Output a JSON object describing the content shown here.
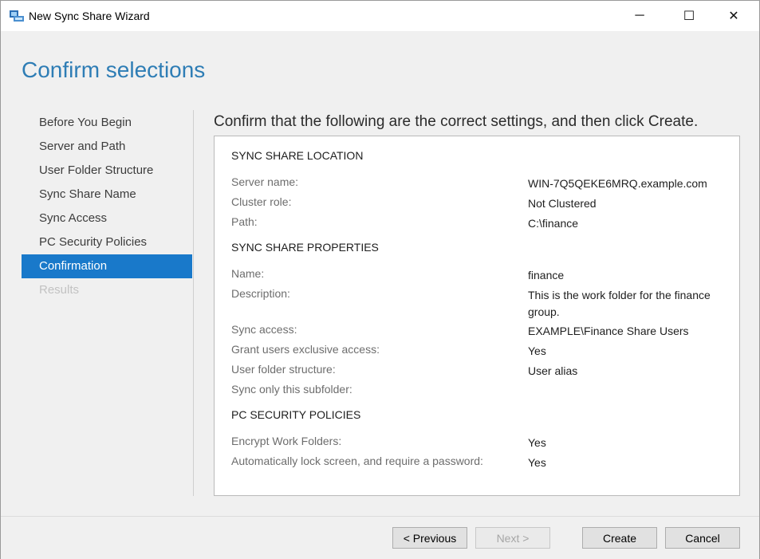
{
  "window": {
    "title": "New Sync Share Wizard",
    "icon": "sync-share-wizard-icon",
    "minimize_glyph": "─",
    "maximize_glyph": "☐",
    "close_glyph": "✕"
  },
  "page": {
    "title": "Confirm selections"
  },
  "nav": {
    "items": [
      {
        "label": "Before You Begin",
        "state": "normal"
      },
      {
        "label": "Server and Path",
        "state": "normal"
      },
      {
        "label": "User Folder Structure",
        "state": "normal"
      },
      {
        "label": "Sync Share Name",
        "state": "normal"
      },
      {
        "label": "Sync Access",
        "state": "normal"
      },
      {
        "label": "PC Security Policies",
        "state": "normal"
      },
      {
        "label": "Confirmation",
        "state": "active"
      },
      {
        "label": "Results",
        "state": "disabled"
      }
    ]
  },
  "content": {
    "heading": "Confirm that the following are the correct settings, and then click Create.",
    "sections": [
      {
        "title": "SYNC SHARE LOCATION",
        "rows": [
          {
            "key": "Server name:",
            "value": "WIN-7Q5QEKE6MRQ.example.com"
          },
          {
            "key": "Cluster role:",
            "value": "Not Clustered"
          },
          {
            "key": "Path:",
            "value": "C:\\finance"
          }
        ]
      },
      {
        "title": "SYNC SHARE PROPERTIES",
        "rows": [
          {
            "key": "Name:",
            "value": "finance"
          },
          {
            "key": "Description:",
            "value": "This is the work folder for the finance group."
          },
          {
            "key": "Sync access:",
            "value": "EXAMPLE\\Finance Share Users"
          },
          {
            "key": "Grant users exclusive access:",
            "value": "Yes"
          },
          {
            "key": "User folder structure:",
            "value": "User alias"
          },
          {
            "key": "Sync only this subfolder:",
            "value": ""
          }
        ]
      },
      {
        "title": "PC SECURITY POLICIES",
        "rows": [
          {
            "key": "Encrypt Work Folders:",
            "value": "Yes"
          },
          {
            "key": "Automatically lock screen, and require a password:",
            "value": "Yes"
          }
        ]
      }
    ]
  },
  "buttons": {
    "previous": "< Previous",
    "next": "Next >",
    "create": "Create",
    "cancel": "Cancel"
  },
  "colors": {
    "accent": "#1979ca",
    "title": "#2e7db5"
  }
}
